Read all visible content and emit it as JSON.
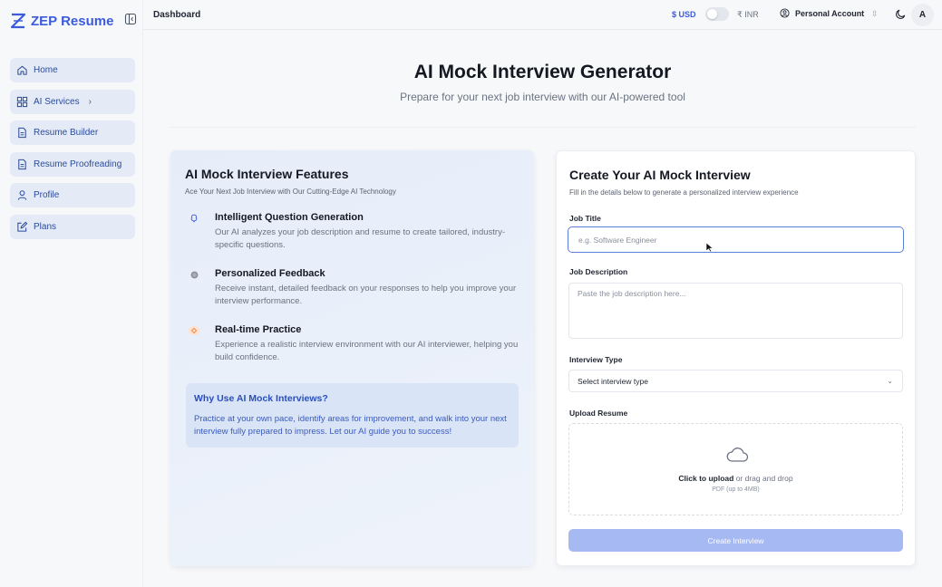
{
  "brand": {
    "name": "ZEP Resume",
    "color": "#3b5bdb"
  },
  "sidebar": {
    "items": [
      {
        "label": "Home",
        "icon": "home-icon"
      },
      {
        "label": "AI Services",
        "icon": "grid-icon",
        "chevron": "›"
      },
      {
        "label": "Resume Builder",
        "icon": "document-icon"
      },
      {
        "label": "Resume Proofreading",
        "icon": "document-icon"
      },
      {
        "label": "Profile",
        "icon": "user-icon"
      },
      {
        "label": "Plans",
        "icon": "edit-icon"
      }
    ]
  },
  "topbar": {
    "breadcrumb": "Dashboard",
    "currency_usd": "$ USD",
    "currency_inr": "₹ INR",
    "account_label": "Personal Account",
    "account_chevron": "⇳",
    "avatar_initial": "A"
  },
  "header": {
    "title": "AI Mock Interview Generator",
    "subtitle": "Prepare for your next job interview with our AI-powered tool"
  },
  "features": {
    "title": "AI Mock Interview Features",
    "subtitle": "Ace Your Next Job Interview with Our Cutting-Edge AI Technology",
    "items": [
      {
        "title": "Intelligent Question Generation",
        "description": "Our AI analyzes your job description and resume to create tailored, industry-specific questions.",
        "icon": "brain-icon"
      },
      {
        "title": "Personalized Feedback",
        "description": "Receive instant, detailed feedback on your responses to help you improve your interview performance.",
        "icon": "feedback-dot-icon"
      },
      {
        "title": "Real-time Practice",
        "description": "Experience a realistic interview environment with our AI interviewer, helping you build confidence.",
        "icon": "practice-icon"
      }
    ],
    "why": {
      "title": "Why Use AI Mock Interviews?",
      "text": "Practice at your own pace, identify areas for improvement, and walk into your next interview fully prepared to impress. Let our AI guide you to success!"
    }
  },
  "form": {
    "title": "Create Your AI Mock Interview",
    "subtitle": "Fill in the details below to generate a personalized interview experience",
    "job_title": {
      "label": "Job Title",
      "placeholder": "e.g. Software Engineer",
      "value": ""
    },
    "job_description": {
      "label": "Job Description",
      "placeholder": "Paste the job description here...",
      "value": ""
    },
    "interview_type": {
      "label": "Interview Type",
      "selected": "Select interview type",
      "chevron": "⌄"
    },
    "upload": {
      "label": "Upload Resume",
      "cta_bold": "Click to upload",
      "cta_rest": " or drag and drop",
      "hint": "PDF (up to 4MB)",
      "icon": "cloud-icon"
    },
    "submit_label": "Create Interview"
  }
}
